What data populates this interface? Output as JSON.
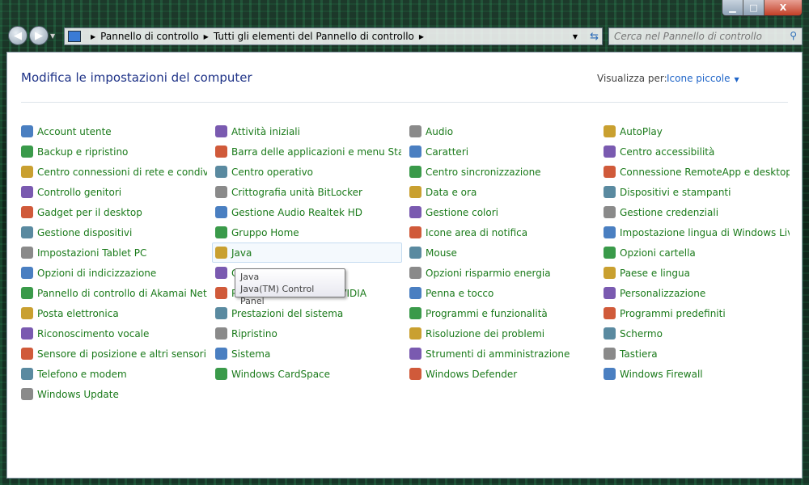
{
  "window": {
    "minimize": "▁",
    "maximize": "□",
    "close": "X"
  },
  "address": {
    "crumbs": [
      "Pannello di controllo",
      "Tutti gli elementi del Pannello di controllo"
    ]
  },
  "search": {
    "placeholder": "Cerca nel Pannello di controllo"
  },
  "header": {
    "title": "Modifica le impostazioni del computer",
    "view_by_label": "Visualizza per:",
    "view_by_value": "Icone piccole"
  },
  "columns": [
    [
      "Account utente",
      "Backup e ripristino",
      "Centro connessioni di rete e condivis...",
      "Controllo genitori",
      "Gadget per il desktop",
      "Gestione dispositivi",
      "Impostazioni Tablet PC",
      "Opzioni di indicizzazione",
      "Pannello di controllo di Akamai NetS...",
      "Posta elettronica",
      "Riconoscimento vocale",
      "Sensore di posizione e altri sensori",
      "Telefono e modem",
      "Windows Update"
    ],
    [
      "Attività iniziali",
      "Barra delle applicazioni e menu Start",
      "Centro operativo",
      "Crittografia unità BitLocker",
      "Gestione Audio Realtek HD",
      "Gruppo Home",
      "Java",
      "Opzioni Internet",
      "Pannello di controllo NVIDIA",
      "Prestazioni del sistema",
      "Ripristino",
      "Sistema",
      "Windows CardSpace"
    ],
    [
      "Audio",
      "Caratteri",
      "Centro sincronizzazione",
      "Data e ora",
      "Gestione colori",
      "Icone area di notifica",
      "Mouse",
      "Opzioni risparmio energia",
      "Penna e tocco",
      "Programmi e funzionalità",
      "Risoluzione dei problemi",
      "Strumenti di amministrazione",
      "Windows Defender"
    ],
    [
      "AutoPlay",
      "Centro accessibilità",
      "Connessione RemoteApp e desktop",
      "Dispositivi e stampanti",
      "Gestione credenziali",
      "Impostazione lingua di Windows Live",
      "Opzioni cartella",
      "Paese e lingua",
      "Personalizzazione",
      "Programmi predefiniti",
      "Schermo",
      "Tastiera",
      "Windows Firewall"
    ]
  ],
  "hovered_item": "Java",
  "tooltip": {
    "title": "Java",
    "description": "Java(TM) Control Panel"
  },
  "colors": {
    "link": "#1a7a1a",
    "title": "#1e3287",
    "accent": "#1e64c8"
  }
}
